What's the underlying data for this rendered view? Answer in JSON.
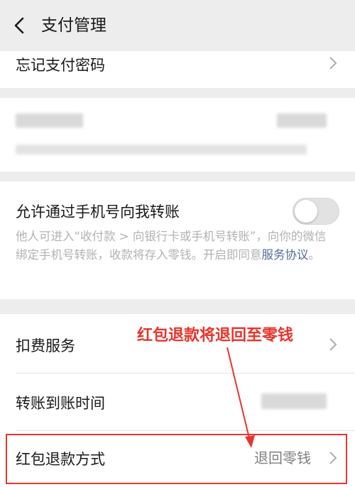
{
  "navbar": {
    "title": "支付管理"
  },
  "rows": {
    "forgot_password": "忘记支付密码",
    "allow_phone_transfer": "允许通过手机号向我转账",
    "deduction_service": "扣费服务",
    "transfer_arrival_time": "转账到账时间",
    "red_packet_refund": "红包退款方式",
    "red_packet_refund_value": "退回零钱"
  },
  "allow_phone_transfer_desc": {
    "text": "他人可进入“收付款 > 向银行卡或手机号转账”，向你的微信绑定手机号转账，收款将存入零钱。开启即同意",
    "link": "服务协议",
    "suffix": "。"
  },
  "toggle": {
    "on": false
  },
  "annotation": {
    "text": "红包退款将退回至零钱",
    "color": "#e8352c"
  },
  "colors": {
    "background": "#ededed",
    "card": "#ffffff",
    "link": "#576b95",
    "annotation": "#e8352c"
  }
}
